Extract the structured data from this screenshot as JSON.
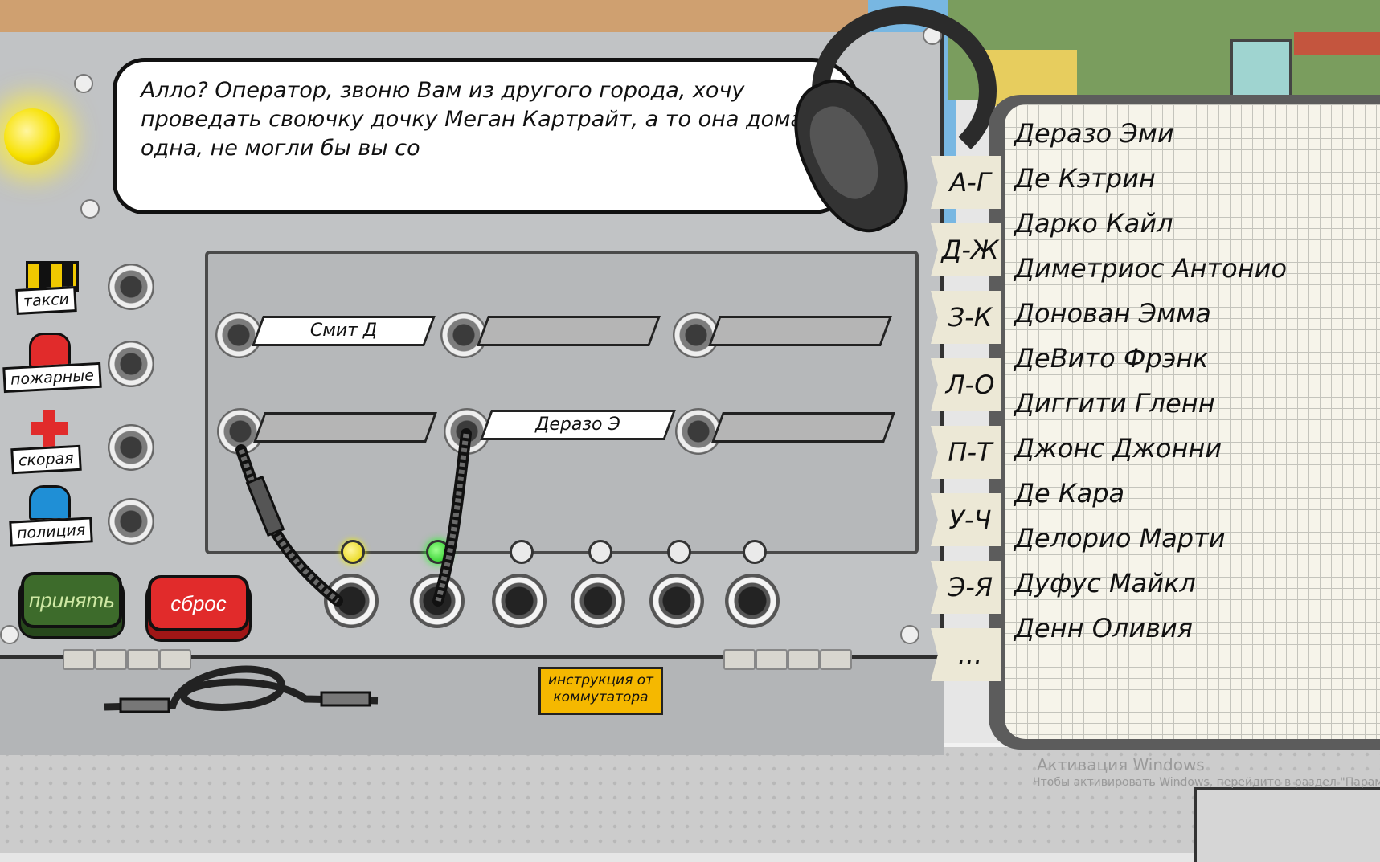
{
  "dialogue": {
    "text": "Алло? Оператор, звоню Вам из другого города, хочу проведать своючку дочку Меган Картрайт, а то она дома одна, не могли бы вы со"
  },
  "services": [
    {
      "label": "такси",
      "icon": "taxi-checker-icon"
    },
    {
      "label": "пожарные",
      "icon": "red-siren-icon"
    },
    {
      "label": "скорая",
      "icon": "red-cross-icon"
    },
    {
      "label": "полиция",
      "icon": "blue-siren-icon"
    }
  ],
  "plates": {
    "row1": [
      "Смит Д",
      "",
      ""
    ],
    "row2": [
      "",
      "Деразо Э",
      ""
    ]
  },
  "leds": [
    "yellow",
    "green",
    "off",
    "off",
    "off",
    "off"
  ],
  "buttons": {
    "accept": "принять",
    "reset": "сброс"
  },
  "instructions": "инструкция от коммутатора",
  "directory": {
    "tabs": [
      "А-Г",
      "Д-Ж",
      "З-К",
      "Л-О",
      "П-Т",
      "У-Ч",
      "Э-Я",
      "..."
    ],
    "names": [
      "Деразо Эми",
      "Де Кэтрин",
      "Дарко Кайл",
      "Диметриос Антонио",
      "Донован Эмма",
      "ДеВито Фрэнк",
      "Диггити Гленн",
      "Джонс Джонни",
      "Де Кара",
      "Делорио Марти",
      "Дуфус Майкл",
      "Денн Оливия"
    ]
  },
  "watermark": {
    "line1": "Активация Windows",
    "line2": "Чтобы активировать Windows, перейдите в раздел \"Параметры\""
  }
}
